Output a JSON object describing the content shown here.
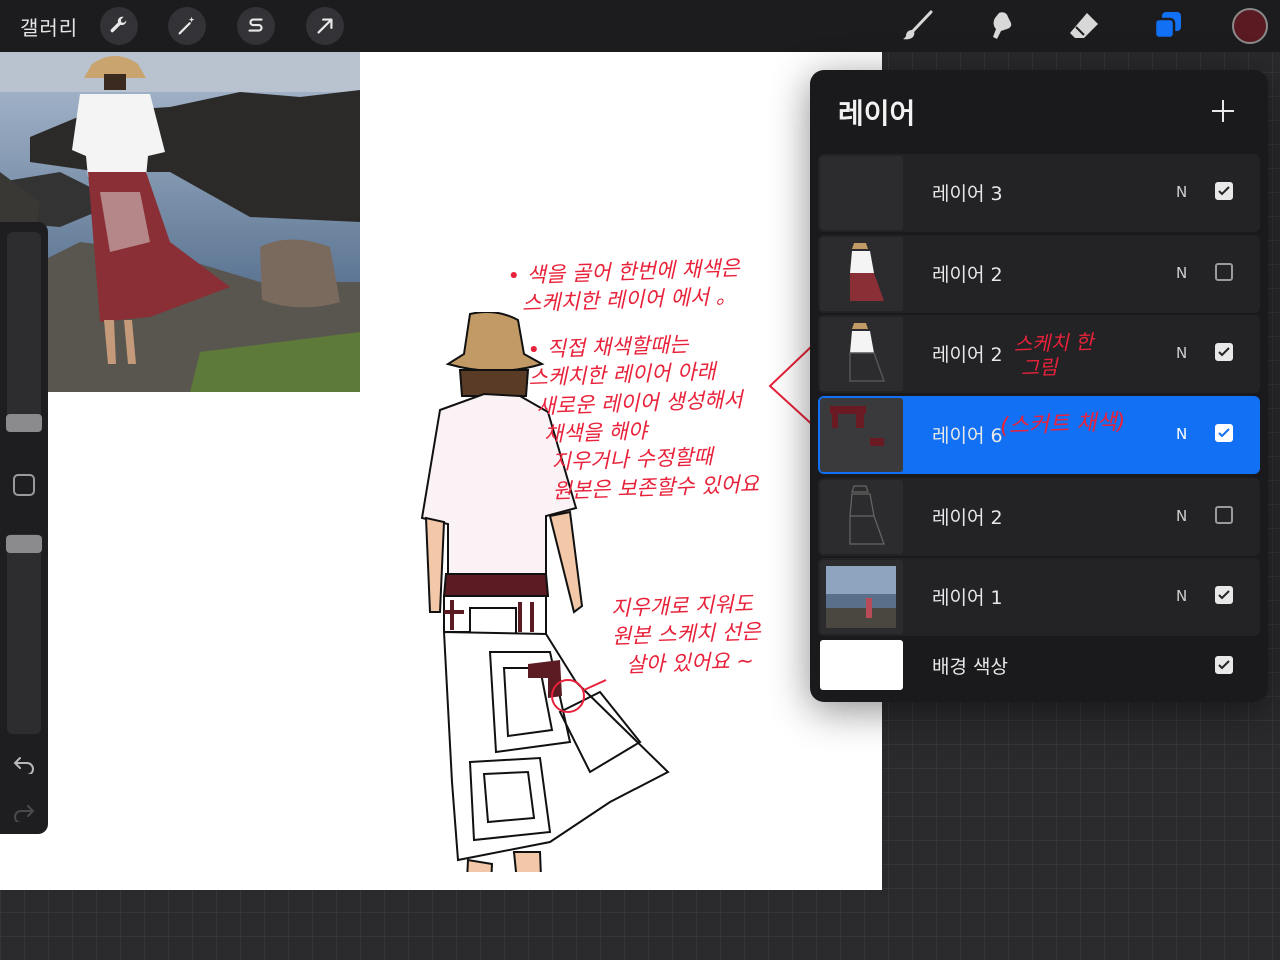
{
  "toolbar": {
    "gallery_label": "갤러리",
    "color_accent": "#1270f5",
    "current_color": "#5a1a22",
    "left_tools": [
      "wrench-icon",
      "magic-wand-icon",
      "selection-s-icon",
      "transform-arrow-icon"
    ],
    "right_tools": [
      "brush-icon",
      "smudge-icon",
      "eraser-icon",
      "layers-icon"
    ]
  },
  "annotations": {
    "note1": "• 색을 골어 한번에 채색은\n  스케치한 레이어 에서 。",
    "note2": "• 직접 채색할때는\n스케치한 레이어 아래\n 새로운 레이어 생성해서\n  채색을 해야\n   지우거나 수정할때\n   원본은 보존할수 있어요",
    "note3": "지우개로 지워도\n원본 스케치 선은\n  살아 있어요 ~",
    "note4": "스케치 한\n 그림",
    "note5": "(스커트 채색)"
  },
  "layers_panel": {
    "title": "레이어",
    "layers": [
      {
        "name": "레이어 3",
        "blend": "N",
        "visible": true,
        "active": false
      },
      {
        "name": "레이어 2",
        "blend": "N",
        "visible": false,
        "active": false
      },
      {
        "name": "레이어 2",
        "blend": "N",
        "visible": true,
        "active": false
      },
      {
        "name": "레이어 6",
        "blend": "N",
        "visible": true,
        "active": true
      },
      {
        "name": "레이어 2",
        "blend": "N",
        "visible": false,
        "active": false
      },
      {
        "name": "레이어 1",
        "blend": "N",
        "visible": true,
        "active": false
      },
      {
        "name": "배경 색상",
        "blend": "",
        "visible": true,
        "active": false
      }
    ]
  }
}
